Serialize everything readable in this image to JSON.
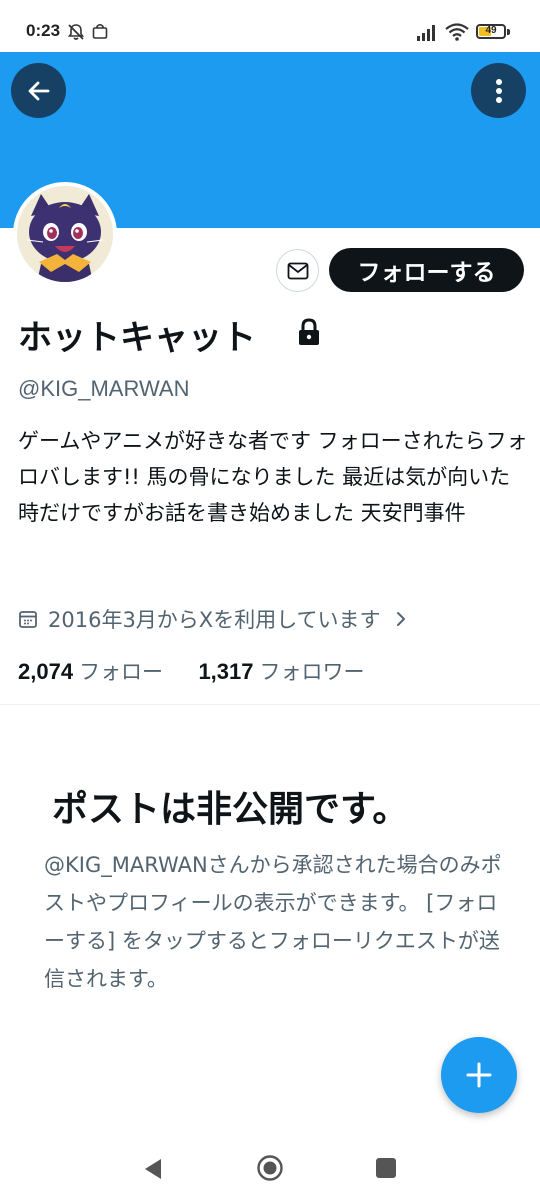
{
  "status_bar": {
    "time": "0:23",
    "battery_level": "49",
    "battery_fraction": 0.49,
    "icons": [
      "mute-bell-icon",
      "shopping-bag-icon",
      "signal-icon",
      "wifi-icon",
      "battery-icon"
    ]
  },
  "header": {
    "banner_color": "#1d9bf0",
    "back_icon": "arrow-left-icon",
    "more_icon": "vertical-dots-icon"
  },
  "profile": {
    "display_name": "ホットキャット",
    "protected_icon": "lock-icon",
    "handle": "@KIG_MARWAN",
    "bio": "ゲームやアニメが好きな者です フォローされたらフォロバします!! 馬の骨になりました 最近は気が向いた時だけですがお話を書き始めました 天安門事件",
    "joined": "2016年3月からXを利用しています",
    "following_count": "2,074",
    "following_label": "フォロー",
    "followers_count": "1,317",
    "followers_label": "フォロワー"
  },
  "actions": {
    "message_icon": "envelope-icon",
    "follow_label": "フォローする"
  },
  "private_notice": {
    "title": "ポストは非公開です。",
    "body": "@KIG_MARWANさんから承認された場合のみポストやプロフィールの表示ができます。 [フォローする] をタップするとフォローリクエストが送信されます。"
  },
  "fab": {
    "icon": "plus-icon"
  },
  "nav_bar": {
    "icons": [
      "nav-back-icon",
      "nav-home-icon",
      "nav-recents-icon"
    ]
  },
  "colors": {
    "accent": "#1d9bf0",
    "text_primary": "#0f1419",
    "text_secondary": "#536471"
  }
}
